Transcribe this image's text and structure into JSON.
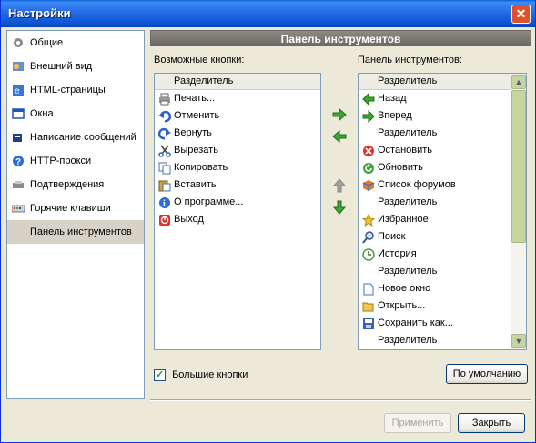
{
  "window": {
    "title": "Настройки"
  },
  "sidebar": {
    "items": [
      {
        "label": "Общие",
        "icon": "gear-icon"
      },
      {
        "label": "Внешний вид",
        "icon": "appearance-icon"
      },
      {
        "label": "HTML-страницы",
        "icon": "globe-icon"
      },
      {
        "label": "Окна",
        "icon": "window-icon"
      },
      {
        "label": "Написание сообщений",
        "icon": "compose-icon"
      },
      {
        "label": "HTTP-прокси",
        "icon": "help-icon"
      },
      {
        "label": "Подтверждения",
        "icon": "confirm-icon"
      },
      {
        "label": "Горячие клавиши",
        "icon": "keyboard-icon"
      },
      {
        "label": "Панель инструментов",
        "icon": "",
        "selected": true
      }
    ]
  },
  "panel": {
    "header": "Панель инструментов",
    "available_label": "Возможные кнопки:",
    "toolbar_label": "Панель инструментов:"
  },
  "available": [
    {
      "label": "Разделитель",
      "icon": ""
    },
    {
      "label": "Печать...",
      "icon": "print-icon"
    },
    {
      "label": "Отменить",
      "icon": "undo-icon"
    },
    {
      "label": "Вернуть",
      "icon": "redo-icon"
    },
    {
      "label": "Вырезать",
      "icon": "cut-icon"
    },
    {
      "label": "Копировать",
      "icon": "copy-icon"
    },
    {
      "label": "Вставить",
      "icon": "paste-icon"
    },
    {
      "label": "О программе...",
      "icon": "about-icon"
    },
    {
      "label": "Выход",
      "icon": "exit-icon"
    }
  ],
  "toolbar": [
    {
      "label": "Разделитель",
      "icon": ""
    },
    {
      "label": "Назад",
      "icon": "back-icon"
    },
    {
      "label": "Вперед",
      "icon": "forward-icon"
    },
    {
      "label": "Разделитель",
      "icon": ""
    },
    {
      "label": "Остановить",
      "icon": "stop-icon"
    },
    {
      "label": "Обновить",
      "icon": "refresh-icon"
    },
    {
      "label": "Список форумов",
      "icon": "forums-icon"
    },
    {
      "label": "Разделитель",
      "icon": ""
    },
    {
      "label": "Избранное",
      "icon": "star-icon"
    },
    {
      "label": "Поиск",
      "icon": "search-icon"
    },
    {
      "label": "История",
      "icon": "history-icon"
    },
    {
      "label": "Разделитель",
      "icon": ""
    },
    {
      "label": "Новое окно",
      "icon": "new-window-icon"
    },
    {
      "label": "Открыть...",
      "icon": "open-icon"
    },
    {
      "label": "Сохранить как...",
      "icon": "save-icon"
    },
    {
      "label": "Разделитель",
      "icon": ""
    }
  ],
  "options": {
    "big_buttons_label": "Большие кнопки",
    "big_buttons_checked": true
  },
  "buttons": {
    "defaults": "По умолчанию",
    "apply": "Применить",
    "close": "Закрыть"
  },
  "colors": {
    "title_blue": "#0b55d4",
    "arrow_green": "#3aa832",
    "arrow_gray": "#a0a0a0",
    "close_red": "#e0502a"
  }
}
